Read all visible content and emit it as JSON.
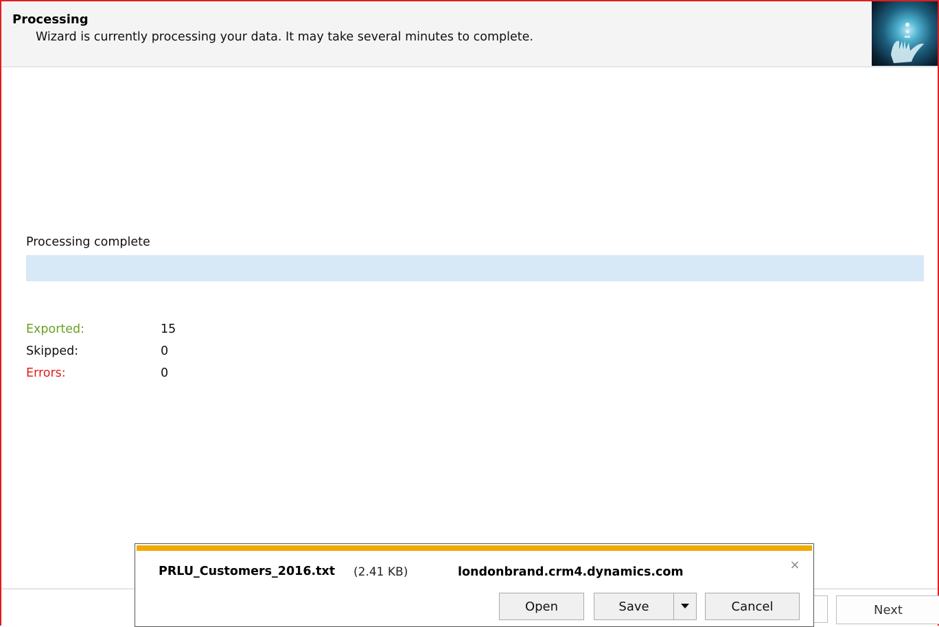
{
  "header": {
    "title": "Processing",
    "subtitle": "Wizard is currently processing your data. It may take several minutes to complete."
  },
  "progress": {
    "label": "Processing complete",
    "fraction": 1.0
  },
  "stats": [
    {
      "label": "Exported:",
      "value": "15",
      "color": "#6aa121"
    },
    {
      "label": "Skipped:",
      "value": "0",
      "color": "#111111"
    },
    {
      "label": "Errors:",
      "value": "0",
      "color": "#e11d1d"
    }
  ],
  "footer": {
    "next_label": "Next"
  },
  "download": {
    "filename": "PRLU_Customers_2016.txt",
    "size": "(2.41 KB)",
    "host": "londonbrand.crm4.dynamics.com",
    "close_icon": "×",
    "open_label": "Open",
    "save_label": "Save",
    "cancel_label": "Cancel",
    "accent_color": "#f0aa00"
  },
  "colors": {
    "frame_border": "#e11d1d",
    "progress_bar": "#d7e8f6"
  }
}
